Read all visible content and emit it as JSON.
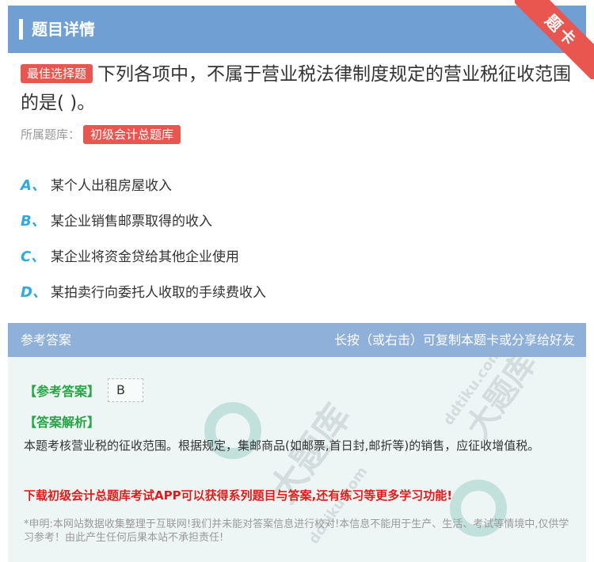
{
  "header": {
    "title": "题目详情",
    "corner_label": "题卡"
  },
  "question": {
    "tag": "最佳选择题",
    "text": "下列各项中，不属于营业税法律制度规定的营业税征收范围的是( )。",
    "source_label": "所属题库：",
    "source_value": "初级会计总题库"
  },
  "options": [
    {
      "letter": "A、",
      "text": "某个人出租房屋收入"
    },
    {
      "letter": "B、",
      "text": "某企业销售邮票取得的收入"
    },
    {
      "letter": "C、",
      "text": "某企业将资金贷给其他企业使用"
    },
    {
      "letter": "D、",
      "text": "某拍卖行向委托人收取的手续费收入"
    }
  ],
  "answer": {
    "head_left": "参考答案",
    "head_right": "长按（或右击）可复制本题卡或分享给好友",
    "ref_label": "【参考答案】",
    "ref_value": "B",
    "analysis_label": "【答案解析】",
    "analysis_text": "本题考核营业税的征收范围。根据规定，集邮商品(如邮票,首日封,邮折等)的销售，应征收增值税。",
    "promo": "下载初级会计总题库考试APP可以获得系列题目与答案,还有练习等更多学习功能!",
    "disclaimer": "*申明:本网站数据收集整理于互联网!我们并未能对答案信息进行校对!本信息不能用于生产、生活、考试等情境中,仅供学习参考！由此产生任何后果本站不承担责任!"
  },
  "watermark": {
    "brand": "大题库",
    "site": "ddtiku.com"
  }
}
